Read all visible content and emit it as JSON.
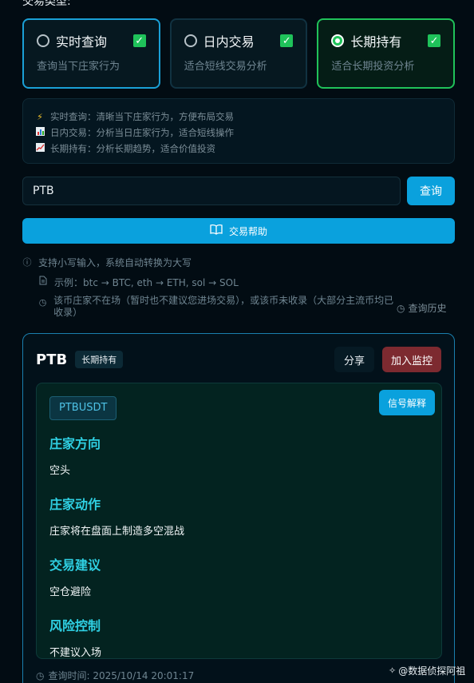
{
  "section_title": "交易类型:",
  "trade_types": [
    {
      "name": "实时查询",
      "desc": "查询当下庄家行为",
      "selected": false,
      "checked": true
    },
    {
      "name": "日内交易",
      "desc": "适合短线交易分析",
      "selected": false,
      "checked": true
    },
    {
      "name": "长期持有",
      "desc": "适合长期投资分析",
      "selected": true,
      "checked": true
    }
  ],
  "info_lines": [
    {
      "icon": "lightning-icon",
      "text": "实时查询：清晰当下庄家行为，方便布局交易"
    },
    {
      "icon": "bar-chart-icon",
      "text": "日内交易：分析当日庄家行为，适合短线操作"
    },
    {
      "icon": "trend-chart-icon",
      "text": "长期持有：分析长期趋势，适合价值投资"
    }
  ],
  "search": {
    "value": "PTB",
    "button_label": "查询"
  },
  "help_button_label": "交易帮助",
  "hints": {
    "lowercase": "支持小写输入，系统自动转换为大写",
    "example": "示例：btc → BTC, eth → ETH, sol → SOL",
    "warning": "该币庄家不在场（暂时也不建议您进场交易），或该币未收录（大部分主流币均已收录）",
    "history_label": "查询历史"
  },
  "result": {
    "symbol": "PTB",
    "mode_badge": "长期持有",
    "share_label": "分享",
    "monitor_label": "加入监控",
    "pair": "PTBUSDT",
    "explain_label": "信号解释",
    "signals": [
      {
        "title": "庄家方向",
        "value": "空头"
      },
      {
        "title": "庄家动作",
        "value": "庄家将在盘面上制造多空混战"
      },
      {
        "title": "交易建议",
        "value": "空仓避险"
      },
      {
        "title": "风险控制",
        "value": "不建议入场"
      }
    ],
    "query_time": "查询时间: 2025/10/14 20:01:17"
  },
  "watermark": "@数据侦探阿祖",
  "colors": {
    "accent_blue": "#0aa1dd",
    "accent_green": "#1fc25a",
    "danger": "#7d2a30",
    "signal_title": "#2fd0e3"
  }
}
